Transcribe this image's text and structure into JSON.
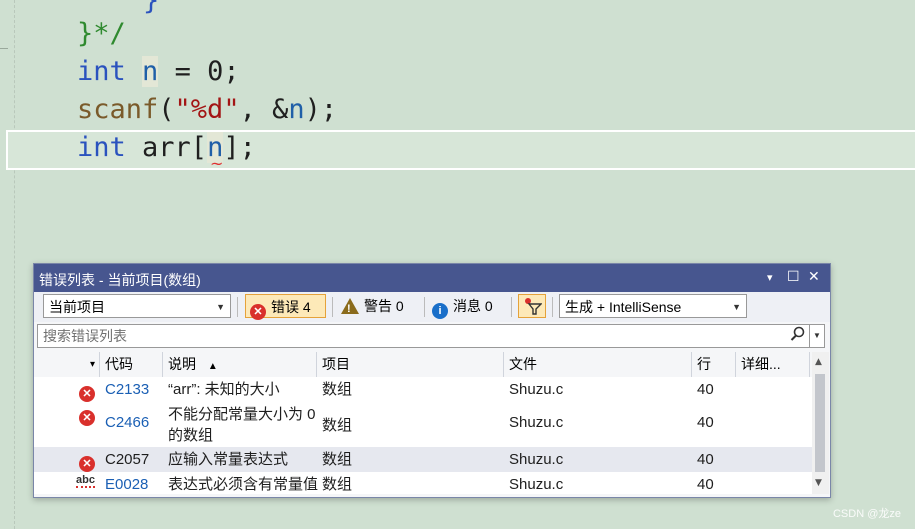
{
  "code": {
    "line0": "}",
    "line1": "}*/",
    "line2": {
      "kw": "int",
      "var": "n",
      "rest": " = 0;"
    },
    "line3": {
      "fn": "scanf",
      "open": "(",
      "str": "\"%d\"",
      "mid": ", &",
      "var": "n",
      "close": ");"
    },
    "line4": {
      "kw": "int",
      "mid": " arr[",
      "var": "n",
      "close": "];"
    },
    "squiggle": "~"
  },
  "panel": {
    "title": "错误列表 - 当前项目(数组)",
    "controls": {
      "dropdown": "▾",
      "maximize": "☐",
      "close": "✕"
    }
  },
  "toolbar": {
    "scope": "当前项目",
    "errors_label": "错误 4",
    "warnings_label": "警告 0",
    "messages_label": "消息 0",
    "build_filter": "生成 + IntelliSense"
  },
  "search": {
    "placeholder": "搜索错误列表"
  },
  "columns": {
    "sort_icon": "▾",
    "code": "代码",
    "description": "说明",
    "sort_arrow": "▲",
    "project": "项目",
    "file": "文件",
    "line": "行",
    "details": "详细..."
  },
  "rows": [
    {
      "icon": "error-icon",
      "code": "C2133",
      "description": "“arr”: 未知的大小",
      "project": "数组",
      "file": "Shuzu.c",
      "line": "40",
      "linked": true
    },
    {
      "icon": "error-icon",
      "code": "C2466",
      "description_l1": "不能分配常量大小为 0",
      "description_l2": "的数组",
      "project": "数组",
      "file": "Shuzu.c",
      "line": "40",
      "linked": true
    },
    {
      "icon": "error-icon",
      "code": "C2057",
      "description": "应输入常量表达式",
      "project": "数组",
      "file": "Shuzu.c",
      "line": "40",
      "linked": false
    },
    {
      "icon": "abc",
      "code": "E0028",
      "description": "表达式必须含有常量值",
      "project": "数组",
      "file": "Shuzu.c",
      "line": "40",
      "linked": true
    }
  ],
  "watermark": "CSDN @龙ze",
  "colors": {
    "title_bg": "#47568f",
    "editor_bg": "#cfe0d1",
    "error": "#d9302c",
    "link": "#1a5fb4"
  }
}
